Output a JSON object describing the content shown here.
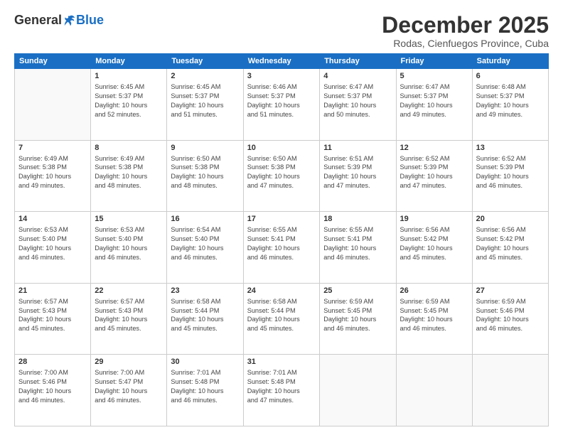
{
  "header": {
    "logo": {
      "general": "General",
      "blue": "Blue"
    },
    "title": "December 2025",
    "location": "Rodas, Cienfuegos Province, Cuba"
  },
  "weekdays": [
    "Sunday",
    "Monday",
    "Tuesday",
    "Wednesday",
    "Thursday",
    "Friday",
    "Saturday"
  ],
  "weeks": [
    [
      {
        "day": "",
        "info": ""
      },
      {
        "day": "1",
        "info": "Sunrise: 6:45 AM\nSunset: 5:37 PM\nDaylight: 10 hours\nand 52 minutes."
      },
      {
        "day": "2",
        "info": "Sunrise: 6:45 AM\nSunset: 5:37 PM\nDaylight: 10 hours\nand 51 minutes."
      },
      {
        "day": "3",
        "info": "Sunrise: 6:46 AM\nSunset: 5:37 PM\nDaylight: 10 hours\nand 51 minutes."
      },
      {
        "day": "4",
        "info": "Sunrise: 6:47 AM\nSunset: 5:37 PM\nDaylight: 10 hours\nand 50 minutes."
      },
      {
        "day": "5",
        "info": "Sunrise: 6:47 AM\nSunset: 5:37 PM\nDaylight: 10 hours\nand 49 minutes."
      },
      {
        "day": "6",
        "info": "Sunrise: 6:48 AM\nSunset: 5:37 PM\nDaylight: 10 hours\nand 49 minutes."
      }
    ],
    [
      {
        "day": "7",
        "info": "Sunrise: 6:49 AM\nSunset: 5:38 PM\nDaylight: 10 hours\nand 49 minutes."
      },
      {
        "day": "8",
        "info": "Sunrise: 6:49 AM\nSunset: 5:38 PM\nDaylight: 10 hours\nand 48 minutes."
      },
      {
        "day": "9",
        "info": "Sunrise: 6:50 AM\nSunset: 5:38 PM\nDaylight: 10 hours\nand 48 minutes."
      },
      {
        "day": "10",
        "info": "Sunrise: 6:50 AM\nSunset: 5:38 PM\nDaylight: 10 hours\nand 47 minutes."
      },
      {
        "day": "11",
        "info": "Sunrise: 6:51 AM\nSunset: 5:39 PM\nDaylight: 10 hours\nand 47 minutes."
      },
      {
        "day": "12",
        "info": "Sunrise: 6:52 AM\nSunset: 5:39 PM\nDaylight: 10 hours\nand 47 minutes."
      },
      {
        "day": "13",
        "info": "Sunrise: 6:52 AM\nSunset: 5:39 PM\nDaylight: 10 hours\nand 46 minutes."
      }
    ],
    [
      {
        "day": "14",
        "info": "Sunrise: 6:53 AM\nSunset: 5:40 PM\nDaylight: 10 hours\nand 46 minutes."
      },
      {
        "day": "15",
        "info": "Sunrise: 6:53 AM\nSunset: 5:40 PM\nDaylight: 10 hours\nand 46 minutes."
      },
      {
        "day": "16",
        "info": "Sunrise: 6:54 AM\nSunset: 5:40 PM\nDaylight: 10 hours\nand 46 minutes."
      },
      {
        "day": "17",
        "info": "Sunrise: 6:55 AM\nSunset: 5:41 PM\nDaylight: 10 hours\nand 46 minutes."
      },
      {
        "day": "18",
        "info": "Sunrise: 6:55 AM\nSunset: 5:41 PM\nDaylight: 10 hours\nand 46 minutes."
      },
      {
        "day": "19",
        "info": "Sunrise: 6:56 AM\nSunset: 5:42 PM\nDaylight: 10 hours\nand 45 minutes."
      },
      {
        "day": "20",
        "info": "Sunrise: 6:56 AM\nSunset: 5:42 PM\nDaylight: 10 hours\nand 45 minutes."
      }
    ],
    [
      {
        "day": "21",
        "info": "Sunrise: 6:57 AM\nSunset: 5:43 PM\nDaylight: 10 hours\nand 45 minutes."
      },
      {
        "day": "22",
        "info": "Sunrise: 6:57 AM\nSunset: 5:43 PM\nDaylight: 10 hours\nand 45 minutes."
      },
      {
        "day": "23",
        "info": "Sunrise: 6:58 AM\nSunset: 5:44 PM\nDaylight: 10 hours\nand 45 minutes."
      },
      {
        "day": "24",
        "info": "Sunrise: 6:58 AM\nSunset: 5:44 PM\nDaylight: 10 hours\nand 45 minutes."
      },
      {
        "day": "25",
        "info": "Sunrise: 6:59 AM\nSunset: 5:45 PM\nDaylight: 10 hours\nand 46 minutes."
      },
      {
        "day": "26",
        "info": "Sunrise: 6:59 AM\nSunset: 5:45 PM\nDaylight: 10 hours\nand 46 minutes."
      },
      {
        "day": "27",
        "info": "Sunrise: 6:59 AM\nSunset: 5:46 PM\nDaylight: 10 hours\nand 46 minutes."
      }
    ],
    [
      {
        "day": "28",
        "info": "Sunrise: 7:00 AM\nSunset: 5:46 PM\nDaylight: 10 hours\nand 46 minutes."
      },
      {
        "day": "29",
        "info": "Sunrise: 7:00 AM\nSunset: 5:47 PM\nDaylight: 10 hours\nand 46 minutes."
      },
      {
        "day": "30",
        "info": "Sunrise: 7:01 AM\nSunset: 5:48 PM\nDaylight: 10 hours\nand 46 minutes."
      },
      {
        "day": "31",
        "info": "Sunrise: 7:01 AM\nSunset: 5:48 PM\nDaylight: 10 hours\nand 47 minutes."
      },
      {
        "day": "",
        "info": ""
      },
      {
        "day": "",
        "info": ""
      },
      {
        "day": "",
        "info": ""
      }
    ]
  ]
}
